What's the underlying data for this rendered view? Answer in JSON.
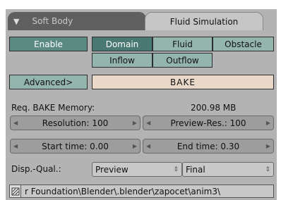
{
  "tabs": {
    "soft_body": "Soft Body",
    "fluid_simulation": "Fluid Simulation"
  },
  "enable_label": "Enable",
  "type_buttons": {
    "domain": "Domain",
    "fluid": "Fluid",
    "obstacle": "Obstacle",
    "inflow": "Inflow",
    "outflow": "Outflow"
  },
  "advanced_label": "Advanced>",
  "bake_label": "BAKE",
  "req_memory": {
    "label": "Req. BAKE Memory:",
    "value": "200.98 MB"
  },
  "resolution": "Resolution: 100",
  "preview_res": "Preview-Res.: 100",
  "start_time": "Start time: 0.00",
  "end_time": "End time: 0.30",
  "disp_qual": {
    "label": "Disp.-Qual.:",
    "viewport": "Preview",
    "render": "Final"
  },
  "path": "r Foundation\\Blender\\.blender\\zapocet\\anim3\\",
  "colors": {
    "panel": "#b3b3b3",
    "enable": "#5a8a82",
    "domain_selected": "#4a7872",
    "type_button": "#94b5ad",
    "bake": "#e9d7c8",
    "number_field": "#9d9d9d"
  }
}
